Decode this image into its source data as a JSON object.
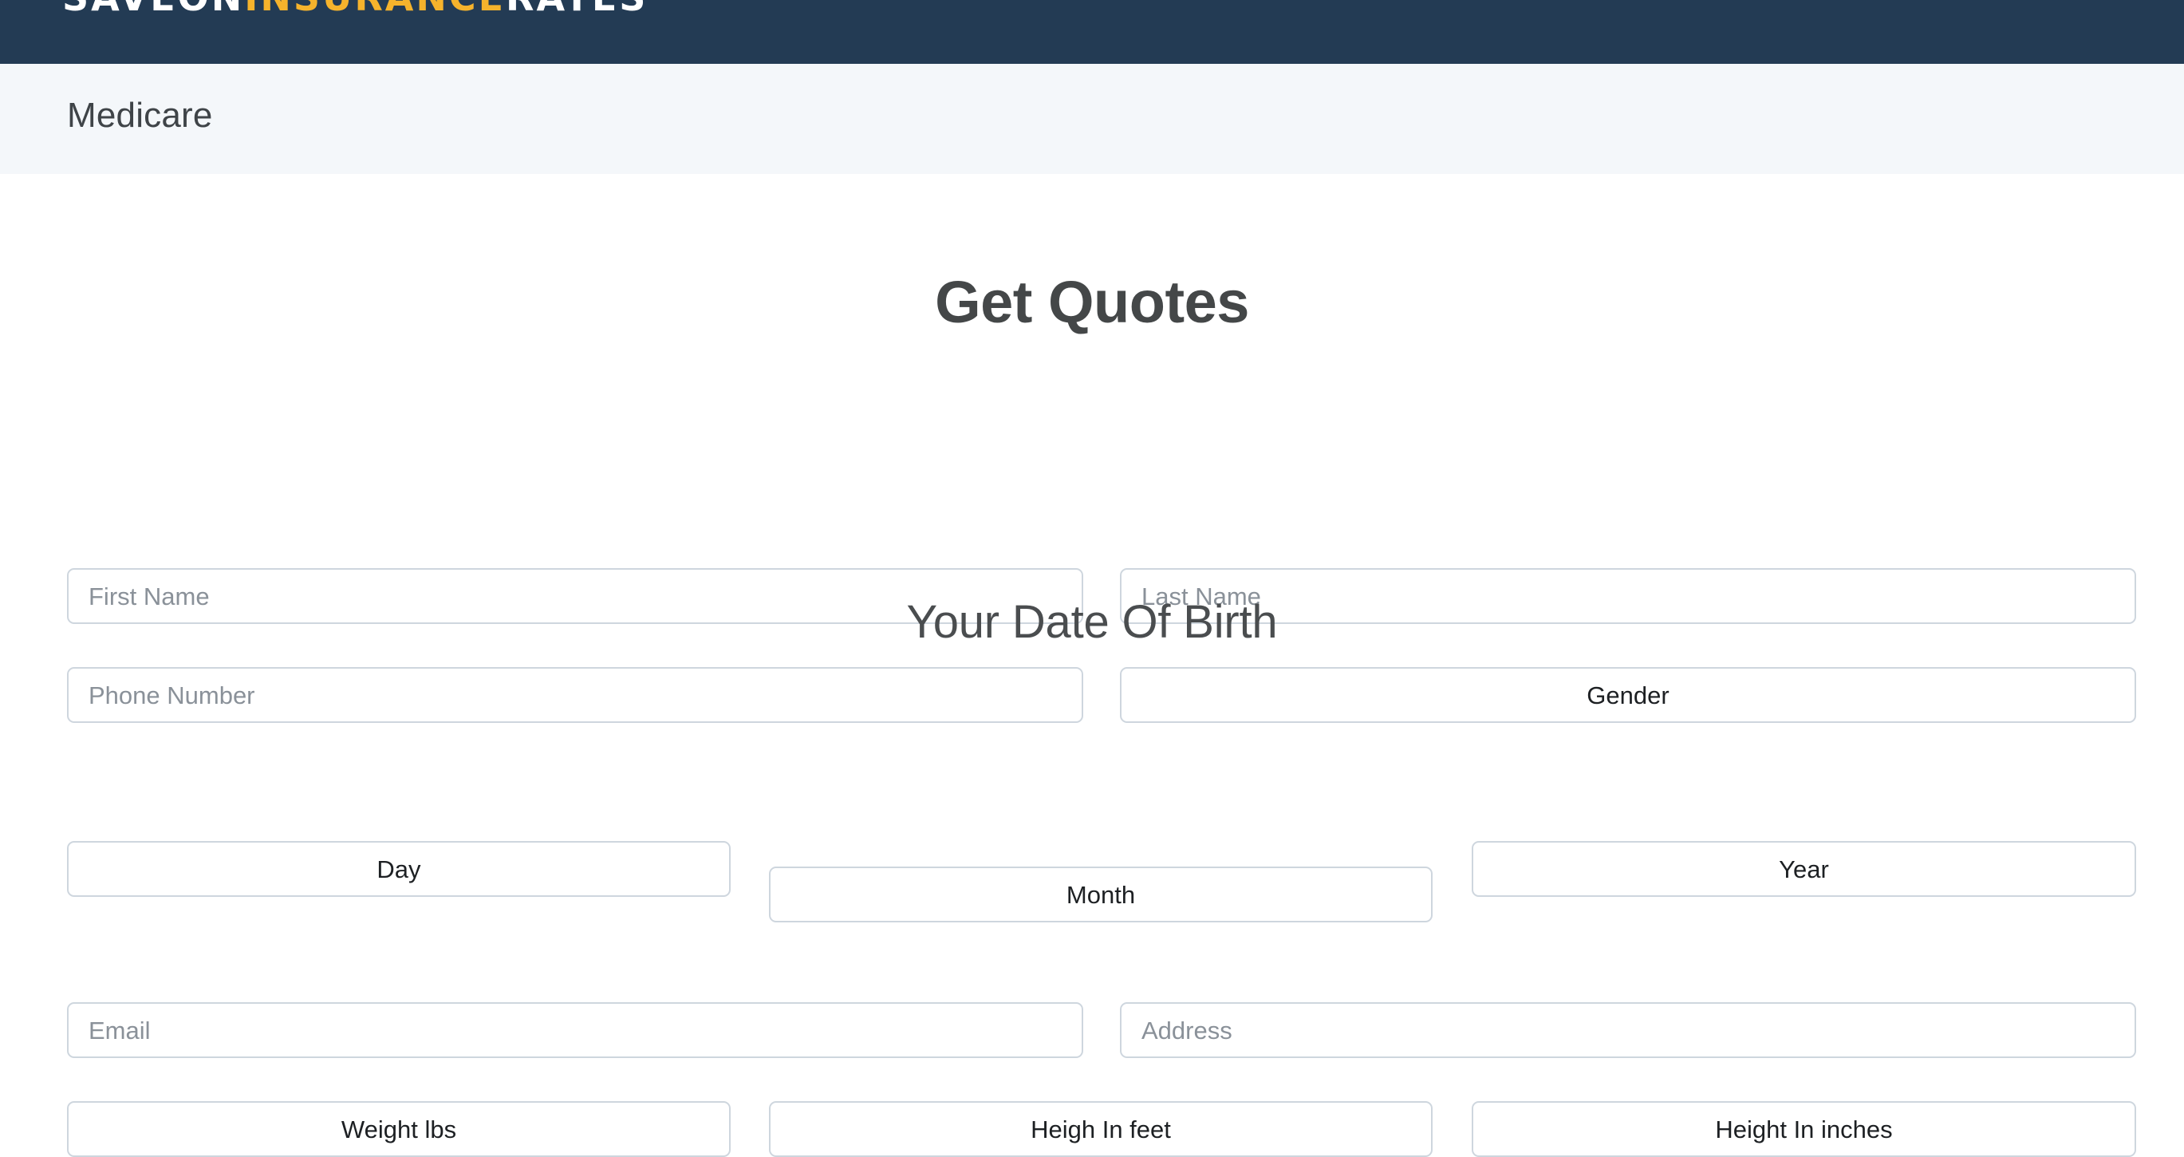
{
  "brand": {
    "logo_part_1": "SAVEON",
    "logo_part_2": "INSURANCE",
    "logo_part_3": "RATES",
    "bar_color": "#233b54",
    "accent_color": "#f5b32c"
  },
  "nav": {
    "items": [
      {
        "label": "Medicare"
      }
    ],
    "band_color": "#f4f7fa"
  },
  "form": {
    "title": "Get Quotes",
    "section_title": "Your Date Of Birth",
    "fields": {
      "first_name": {
        "placeholder": "First Name",
        "value": ""
      },
      "last_name": {
        "placeholder": "Last Name",
        "value": ""
      },
      "phone": {
        "placeholder": "Phone Number",
        "value": ""
      },
      "gender": {
        "selected": "Gender"
      },
      "day": {
        "selected": "Day"
      },
      "month": {
        "selected": "Month"
      },
      "year": {
        "selected": "Year"
      },
      "email": {
        "placeholder": "Email",
        "value": ""
      },
      "address": {
        "placeholder": "Address",
        "value": ""
      },
      "weight": {
        "selected": "Weight lbs"
      },
      "height_feet": {
        "selected": "Heigh In feet"
      },
      "height_inches": {
        "selected": "Height In inches"
      }
    },
    "border_color": "#ced6de",
    "placeholder_color": "#8a9199"
  }
}
